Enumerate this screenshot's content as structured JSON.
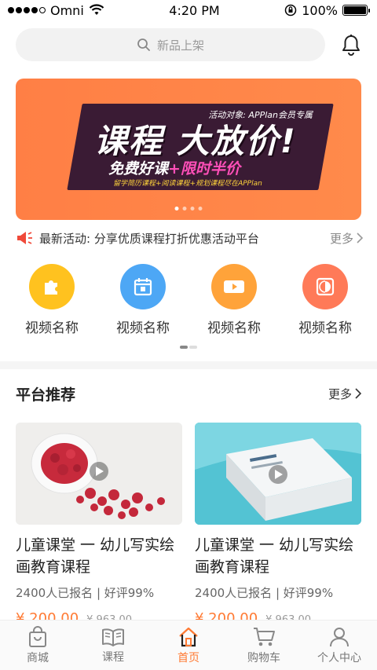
{
  "status_bar": {
    "carrier": "Omni",
    "time": "4:20 PM",
    "battery": "100%"
  },
  "search": {
    "placeholder": "新品上架"
  },
  "banner": {
    "audience": "活动对象: APPlan会员专属",
    "title": "课程 大放价!",
    "subtitle_part1": "免费好课",
    "subtitle_part2": "+限时半价",
    "detail": "留学简历课程+阅读课程+规划课程尽在APPlan",
    "page_count": 4,
    "active_page": 1
  },
  "notice": {
    "text": "最新活动: 分享优质课程打折优惠活动平台",
    "more": "更多"
  },
  "categories": [
    {
      "label": "视频名称",
      "icon": "puzzle-icon",
      "color": "#ffc21f"
    },
    {
      "label": "视频名称",
      "icon": "calendar-icon",
      "color": "#4da7f5"
    },
    {
      "label": "视频名称",
      "icon": "video-camera-icon",
      "color": "#ffa33a"
    },
    {
      "label": "视频名称",
      "icon": "contrast-icon",
      "color": "#ff7a58"
    }
  ],
  "recommend": {
    "title": "平台推荐",
    "more": "更多",
    "items": [
      {
        "title": "儿童课堂 一 幼儿写实绘画教育课程",
        "meta": "2400人已报名 | 好评99%",
        "price": "¥ 200.00",
        "old_price": "¥ 963.00"
      },
      {
        "title": "儿童课堂 一 幼儿写实绘画教育课程",
        "meta": "2400人已报名 | 好评99%",
        "price": "¥ 200.00",
        "old_price": "¥ 963.00"
      }
    ]
  },
  "tabs": [
    {
      "label": "商城",
      "icon": "shopping-bag-icon"
    },
    {
      "label": "课程",
      "icon": "book-icon"
    },
    {
      "label": "首页",
      "icon": "home-icon",
      "active": true
    },
    {
      "label": "购物车",
      "icon": "cart-icon"
    },
    {
      "label": "个人中心",
      "icon": "user-icon"
    }
  ],
  "colors": {
    "accent": "#ff7a33",
    "banner_bg": "#ff8245"
  }
}
